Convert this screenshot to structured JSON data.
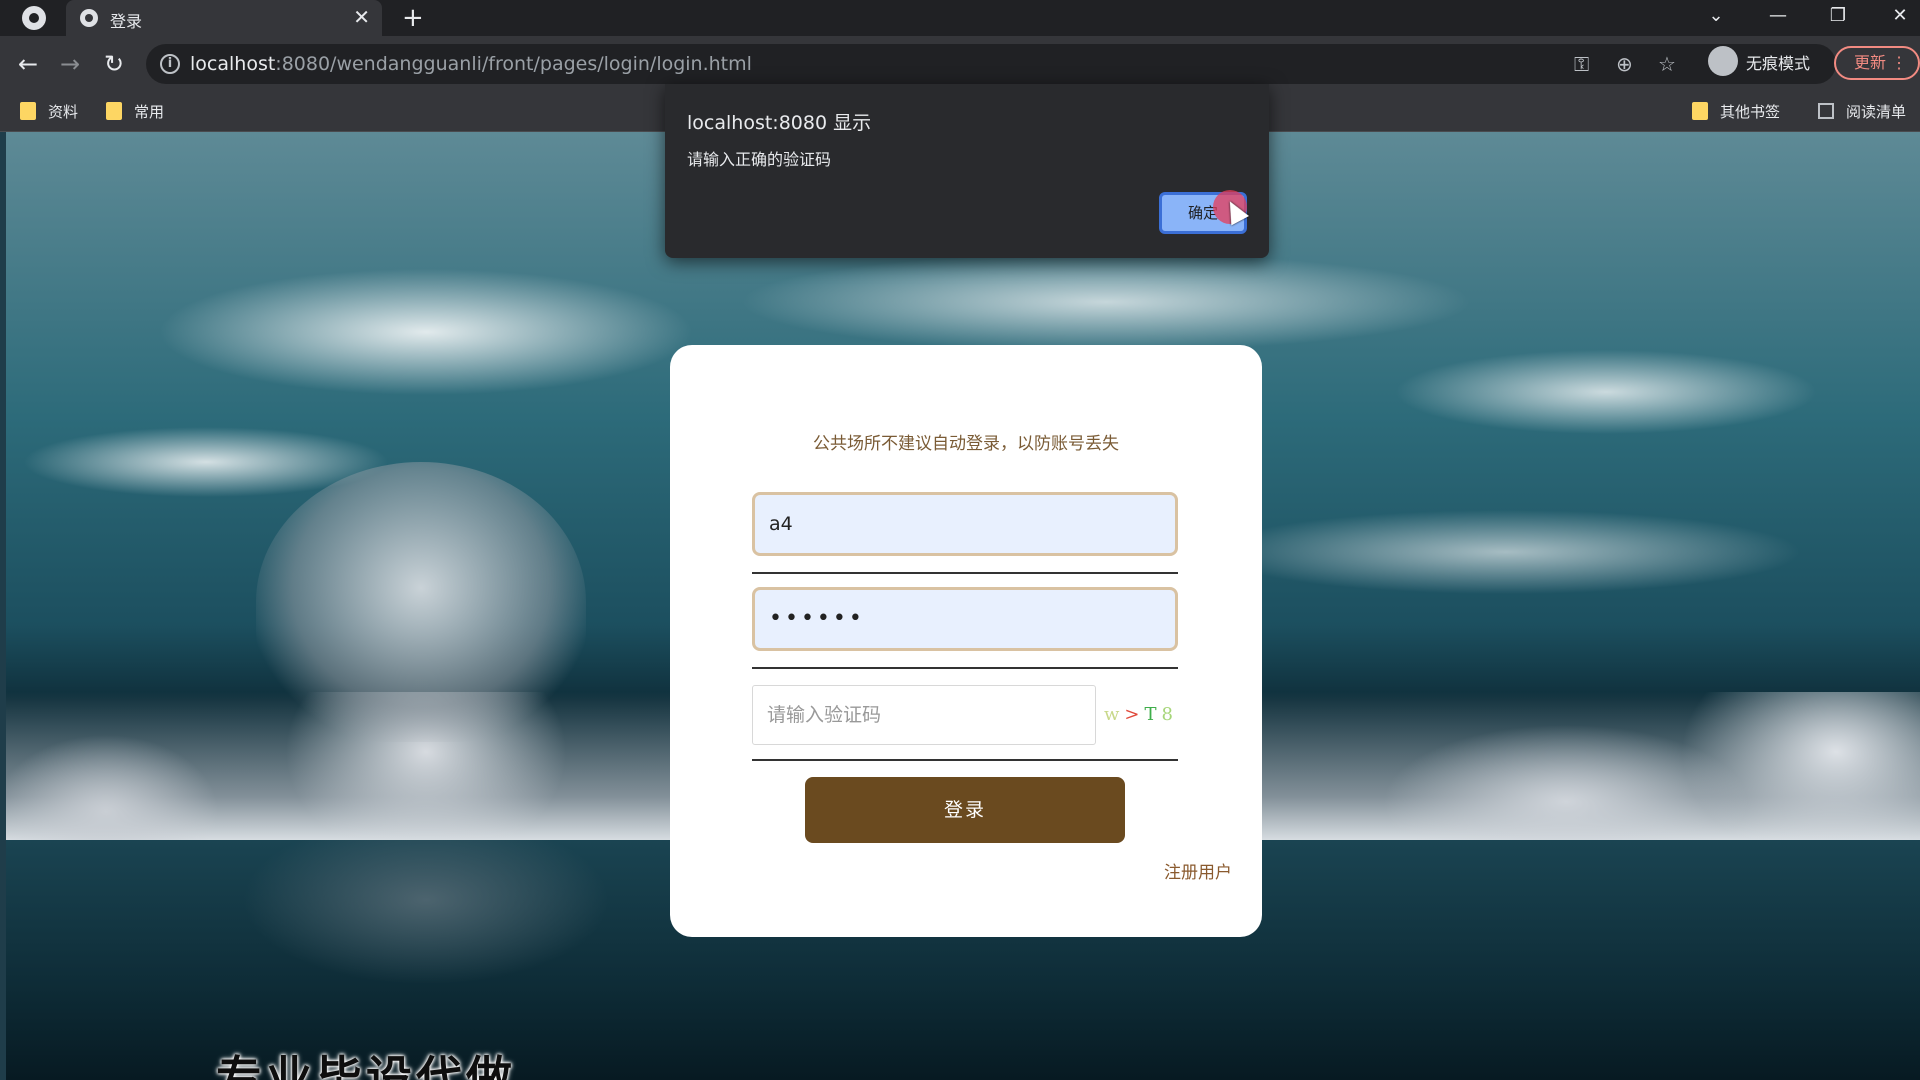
{
  "browser": {
    "tab_title": "登录",
    "url_host": "localhost",
    "url_path": ":8080/wendangguanli/front/pages/login/login.html",
    "incognito_label": "无痕模式",
    "update_label": "更新",
    "bookmarks": [
      {
        "label": "资料"
      },
      {
        "label": "常用"
      }
    ],
    "other_bookmarks": "其他书签",
    "reading_list": "阅读清单"
  },
  "dialog": {
    "title": "localhost:8080 显示",
    "message": "请输入正确的验证码",
    "ok_label": "确定"
  },
  "login": {
    "notice": "公共场所不建议自动登录，以防账号丢失",
    "username_value": "a4",
    "password_value": "••••••",
    "captcha_placeholder": "请输入验证码",
    "captcha_chars": [
      {
        "char": "w",
        "color": "#c8d88a"
      },
      {
        "char": ">",
        "color": "#e0483a"
      },
      {
        "char": "T",
        "color": "#3fae4a"
      },
      {
        "char": "8",
        "color": "#a7d67a"
      }
    ],
    "login_label": "登录",
    "register_label": "注册用户"
  },
  "video_overlay_text": "专业毕设代做"
}
